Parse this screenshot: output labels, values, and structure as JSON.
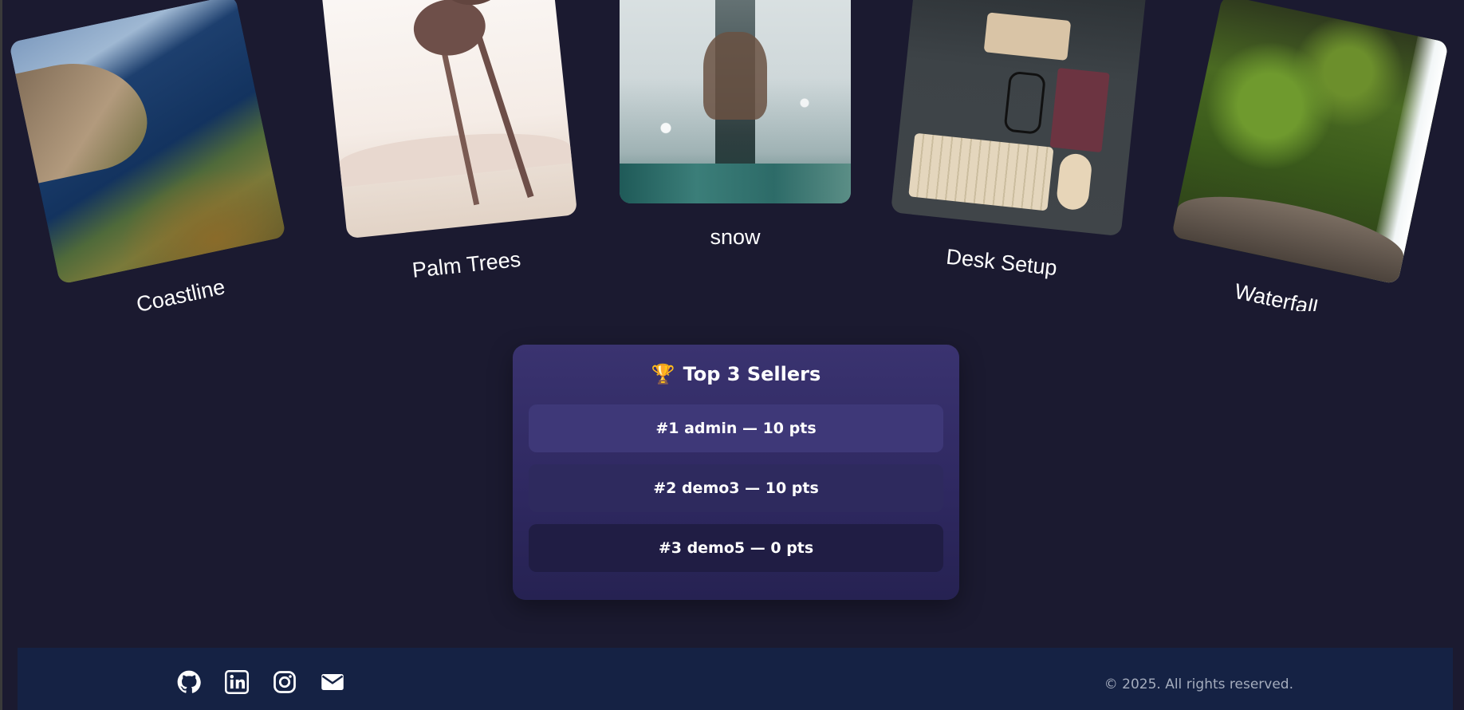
{
  "gallery": {
    "cards": [
      {
        "caption": "Coastline"
      },
      {
        "caption": "Palm Trees"
      },
      {
        "caption": "snow"
      },
      {
        "caption": "Desk Setup"
      },
      {
        "caption": "Waterfall"
      }
    ]
  },
  "leaderboard": {
    "trophy": "🏆",
    "title": "Top 3 Sellers",
    "rows": [
      {
        "text": "#1 admin — 10 pts"
      },
      {
        "text": "#2 demo3 — 10 pts"
      },
      {
        "text": "#3 demo5 — 0 pts"
      }
    ]
  },
  "footer": {
    "social_icons": [
      "github-icon",
      "linkedin-icon",
      "instagram-icon",
      "mail-icon"
    ],
    "copyright": "© 2025. All rights reserved."
  }
}
